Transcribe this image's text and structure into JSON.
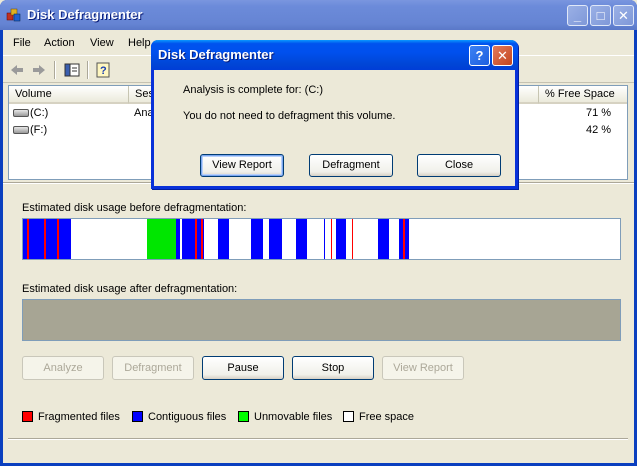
{
  "window": {
    "title": "Disk Defragmenter",
    "controls": {
      "minimize": "_",
      "maximize": "□",
      "close": "✕"
    }
  },
  "menu": [
    "File",
    "Action",
    "View",
    "Help"
  ],
  "toolbar": {
    "icons": [
      "back-arrow",
      "forward-arrow",
      "show-hide-tree",
      "help"
    ]
  },
  "volume_list": {
    "headers": [
      "Volume",
      "Ses",
      "% Free Space"
    ],
    "rows": [
      {
        "volume": "(C:)",
        "session": "Anal",
        "free": "71 %"
      },
      {
        "volume": "(F:)",
        "session": "",
        "free": "42 %"
      }
    ]
  },
  "before_label": "Estimated disk usage before defragmentation:",
  "after_label": "Estimated disk usage after defragmentation:",
  "buttons": {
    "analyze": "Analyze",
    "defragment": "Defragment",
    "pause": "Pause",
    "stop": "Stop",
    "view_report": "View Report"
  },
  "legend": {
    "fragmented": "Fragmented files",
    "contiguous": "Contiguous files",
    "unmovable": "Unmovable files",
    "free": "Free space"
  },
  "colors": {
    "fragmented": "#FF0000",
    "contiguous": "#0000FF",
    "unmovable": "#00FF00",
    "free": "#FFFFFF",
    "after_bar": "#A7A594"
  },
  "dialog": {
    "title": "Disk Defragmenter",
    "line1": "Analysis is complete for: (C:)",
    "line2": "You do not need to defragment this volume.",
    "buttons": {
      "view_report": "View Report",
      "defragment": "Defragment",
      "close": "Close"
    },
    "controls": {
      "help": "?",
      "close": "✕"
    }
  }
}
